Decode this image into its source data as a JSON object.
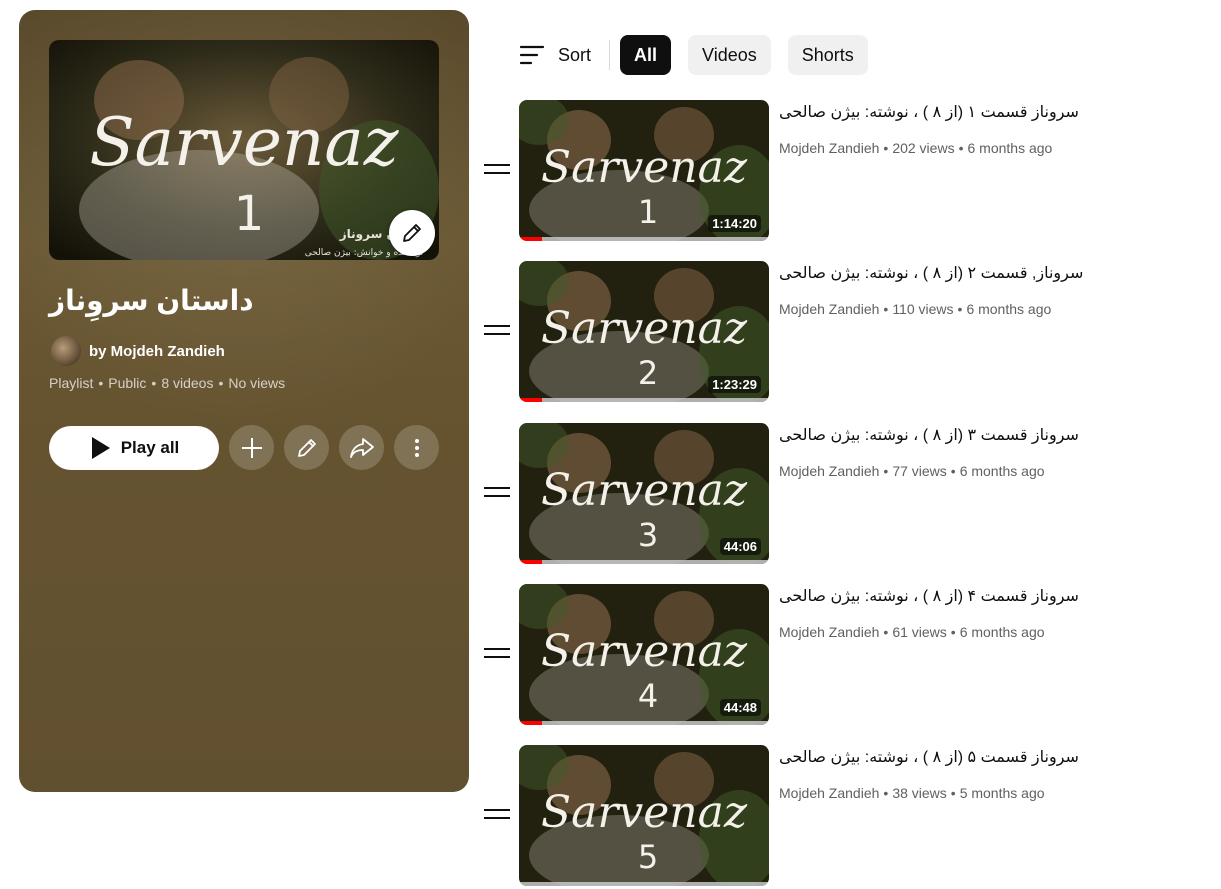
{
  "playlist": {
    "title": "داستان سروِناز",
    "owner": "by Mojdeh Zandieh",
    "meta": {
      "type": "Playlist",
      "privacy": "Public",
      "count": "8 videos",
      "views": "No views"
    },
    "hero_overlay_text": "Sarvenaz",
    "hero_number": "1",
    "hero_caption_1": "داستان سروناز",
    "hero_caption_2": "نویسنده و خوانش: بیژن صالحی"
  },
  "actions": {
    "play_all_label": "Play all"
  },
  "icons": {
    "edit": "pencil-icon",
    "add": "plus-icon",
    "share": "share-icon",
    "more": "more-vert-icon",
    "play": "play-icon",
    "sort": "sort-icon",
    "drag": "drag-handle-icon"
  },
  "toolbar": {
    "sort_label": "Sort",
    "chips": [
      "All",
      "Videos",
      "Shorts"
    ],
    "active_chip": "All"
  },
  "colors": {
    "panel": "#655330",
    "accent_red": "#ff0000",
    "chip_active": "#0f0f0f"
  },
  "videos": [
    {
      "title": "سروناز قسمت ۱ (از ۸ ) ، نوشته: بیژن صالحی",
      "channel": "Mojdeh Zandieh",
      "views": "202 views",
      "age": "6 months ago",
      "duration": "1:14:20",
      "thumb_number": "1",
      "watched_fraction": 0.09
    },
    {
      "title": "سروناز, قسمت ۲ (از ۸ ) ، نوشته: بیژن صالحی",
      "channel": "Mojdeh Zandieh",
      "views": "110 views",
      "age": "6 months ago",
      "duration": "1:23:29",
      "thumb_number": "2",
      "watched_fraction": 0.09
    },
    {
      "title": "سروناز قسمت ۳ (از ۸ ) ، نوشته: بیژن صالحی",
      "channel": "Mojdeh Zandieh",
      "views": "77 views",
      "age": "6 months ago",
      "duration": "44:06",
      "thumb_number": "3",
      "watched_fraction": 0.09
    },
    {
      "title": "سروناز قسمت ۴ (از ۸ ) ، نوشته: بیژن صالحی",
      "channel": "Mojdeh Zandieh",
      "views": "61 views",
      "age": "6 months ago",
      "duration": "44:48",
      "thumb_number": "4",
      "watched_fraction": 0.09
    },
    {
      "title": "سروناز قسمت ۵ (از ۸ ) ، نوشته: بیژن صالحی",
      "channel": "Mojdeh Zandieh",
      "views": "38 views",
      "age": "5 months ago",
      "duration": "",
      "thumb_number": "5",
      "watched_fraction": 0
    }
  ]
}
